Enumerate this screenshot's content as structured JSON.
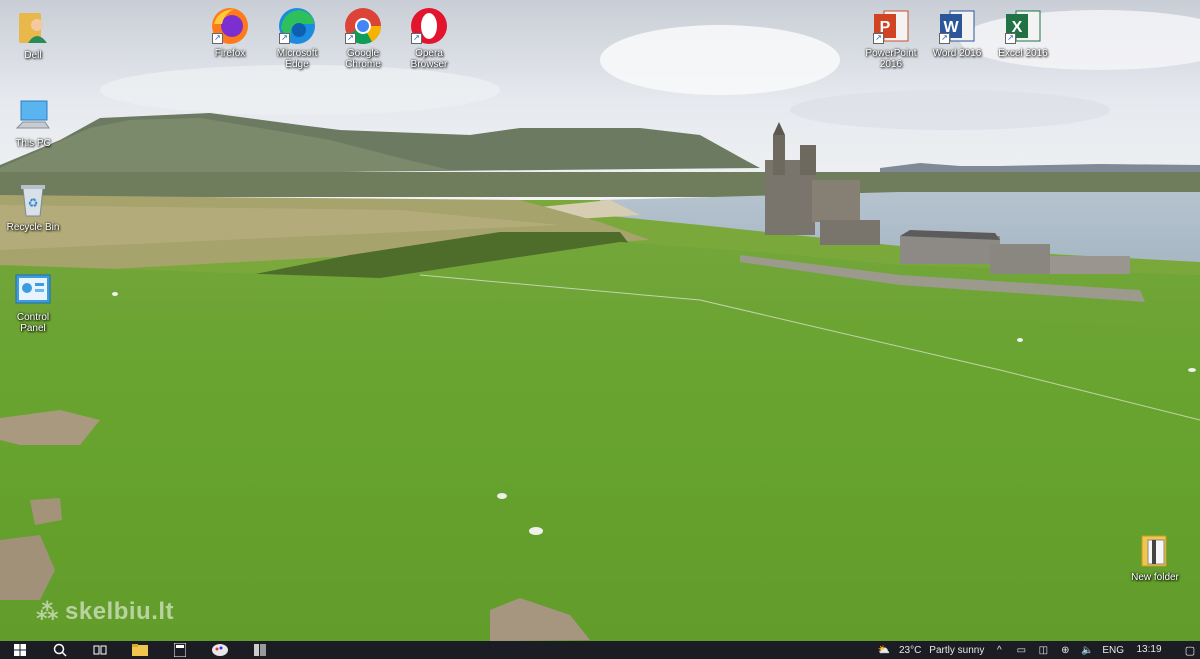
{
  "desktop": {
    "icons": {
      "dell": {
        "label": "Dell"
      },
      "firefox": {
        "label": "Firefox"
      },
      "edge": {
        "label": "Microsoft\nEdge"
      },
      "chrome": {
        "label": "Google\nChrome"
      },
      "opera": {
        "label": "Opera\nBrowser"
      },
      "powerpoint": {
        "label": "PowerPoint\n2016"
      },
      "word": {
        "label": "Word 2016"
      },
      "excel": {
        "label": "Excel 2016"
      },
      "thispc": {
        "label": "This PC"
      },
      "recycle": {
        "label": "Recycle Bin"
      },
      "control": {
        "label": "Control\nPanel"
      },
      "newfolder": {
        "label": "New folder"
      }
    },
    "watermark": "skelbiu.lt"
  },
  "taskbar": {
    "weather_temp": "23°C",
    "weather_desc": "Partly sunny",
    "language": "ENG",
    "time": "13:19"
  },
  "colors": {
    "taskbar": "#1c1c24",
    "grass": "#6fa533",
    "sky": "#dfe4ea"
  }
}
